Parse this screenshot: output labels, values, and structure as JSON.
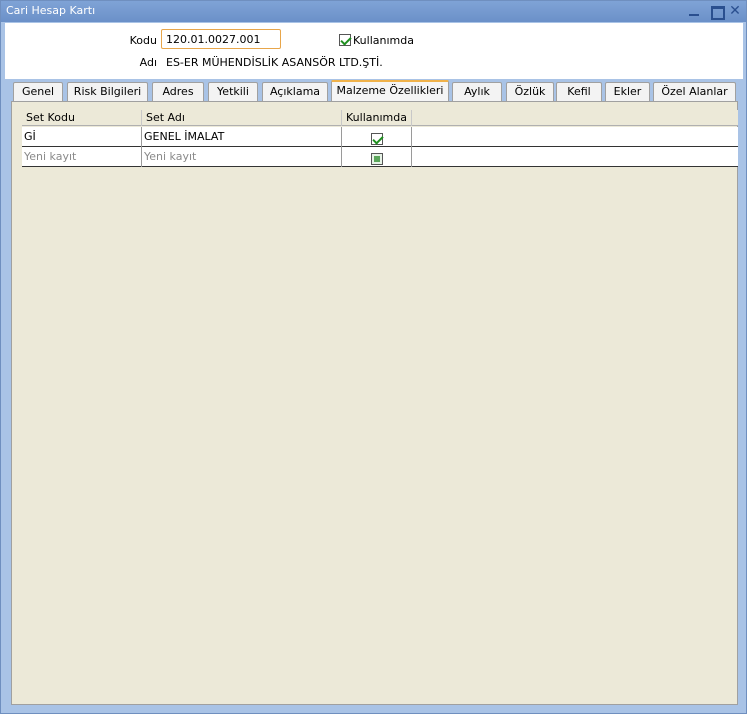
{
  "window": {
    "title": "Cari Hesap Kartı",
    "close_glyph": "✕"
  },
  "header": {
    "kodu_label": "Kodu",
    "kodu_value": "120.01.0027.001",
    "adi_label": "Adı",
    "adi_value": "ES-ER MÜHENDİSLİK ASANSÖR LTD.ŞTİ.",
    "kullanimda_label": "Kullanımda",
    "kullanimda_checked": true
  },
  "tabs": [
    {
      "label": "Genel"
    },
    {
      "label": "Risk Bilgileri"
    },
    {
      "label": "Adres"
    },
    {
      "label": "Yetkili"
    },
    {
      "label": "Açıklama"
    },
    {
      "label": "Malzeme Özellikleri",
      "active": true
    },
    {
      "label": "Aylık"
    },
    {
      "label": "Özlük"
    },
    {
      "label": "Kefil"
    },
    {
      "label": "Ekler"
    },
    {
      "label": "Özel Alanlar"
    }
  ],
  "grid": {
    "columns": [
      "Set Kodu",
      "Set Adı",
      "Kullanımda",
      ""
    ],
    "rows": [
      {
        "set_kodu": "Gİ",
        "set_adi": "GENEL İMALAT",
        "kullanimda": true
      },
      {
        "set_kodu": "Yeni kayıt",
        "set_adi": "Yeni kayıt",
        "kullanimda": "pending"
      }
    ]
  },
  "colors": {
    "accent": "#f0b24a",
    "frame": "#a9c3e6",
    "panel": "#ece9d8"
  }
}
